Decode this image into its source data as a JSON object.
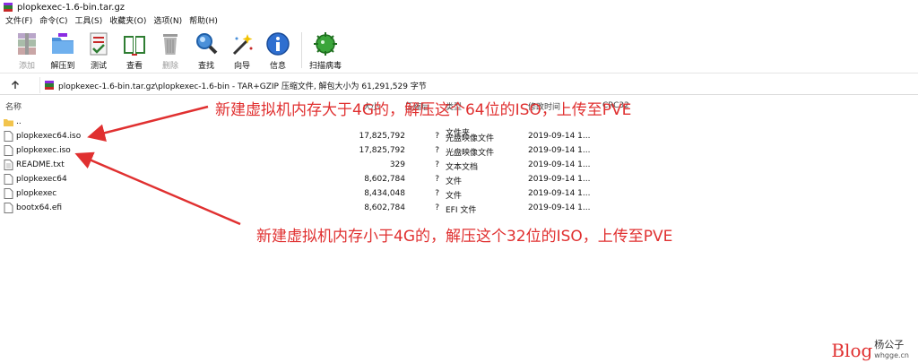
{
  "window": {
    "title": "plopkexec-1.6-bin.tar.gz"
  },
  "menu": [
    "文件(F)",
    "命令(C)",
    "工具(S)",
    "收藏夹(O)",
    "选项(N)",
    "帮助(H)"
  ],
  "toolbar": [
    {
      "label": "添加",
      "icon": "add-archive-icon",
      "disabled": true
    },
    {
      "label": "解压到",
      "icon": "extract-to-icon",
      "disabled": false
    },
    {
      "label": "测试",
      "icon": "test-icon",
      "disabled": false
    },
    {
      "label": "查看",
      "icon": "view-icon",
      "disabled": false
    },
    {
      "label": "删除",
      "icon": "delete-icon",
      "disabled": true
    },
    {
      "label": "查找",
      "icon": "find-icon",
      "disabled": false
    },
    {
      "label": "向导",
      "icon": "wizard-icon",
      "disabled": false
    },
    {
      "label": "信息",
      "icon": "info-icon",
      "disabled": false
    },
    {
      "label": "扫描病毒",
      "icon": "virus-scan-icon",
      "disabled": false
    }
  ],
  "address": {
    "text": "plopkexec-1.6-bin.tar.gz\\plopkexec-1.6-bin - TAR+GZIP 压缩文件, 解包大小为 61,291,529 字节"
  },
  "columns": {
    "name": "名称",
    "size": "大小",
    "packed": "压缩后",
    "type": "类型",
    "modified": "修改时间",
    "crc": "CRC32"
  },
  "files": [
    {
      "name": "..",
      "size": "",
      "packed": "",
      "type": "文件夹",
      "modified": "",
      "icon": "folder-icon"
    },
    {
      "name": "plopkexec64.iso",
      "size": "17,825,792",
      "packed": "?",
      "type": "光盘映像文件",
      "modified": "2019-09-14 1...",
      "icon": "file-icon"
    },
    {
      "name": "plopkexec.iso",
      "size": "17,825,792",
      "packed": "?",
      "type": "光盘映像文件",
      "modified": "2019-09-14 1...",
      "icon": "file-icon"
    },
    {
      "name": "README.txt",
      "size": "329",
      "packed": "?",
      "type": "文本文档",
      "modified": "2019-09-14 1...",
      "icon": "text-file-icon"
    },
    {
      "name": "plopkexec64",
      "size": "8,602,784",
      "packed": "?",
      "type": "文件",
      "modified": "2019-09-14 1...",
      "icon": "file-icon"
    },
    {
      "name": "plopkexec",
      "size": "8,434,048",
      "packed": "?",
      "type": "文件",
      "modified": "2019-09-14 1...",
      "icon": "file-icon"
    },
    {
      "name": "bootx64.efi",
      "size": "8,602,784",
      "packed": "?",
      "type": "EFI 文件",
      "modified": "2019-09-14 1...",
      "icon": "file-icon"
    }
  ],
  "annotations": {
    "top": "新建虚拟机内存大于4G的，解压这个64位的ISO，上传至PVE",
    "bottom": "新建虚拟机内存小于4G的，解压这个32位的ISO，上传至PVE",
    "color": "#e03030"
  },
  "watermark": {
    "blog": "Blog",
    "name": "杨公子",
    "url": "whgge.cn"
  }
}
